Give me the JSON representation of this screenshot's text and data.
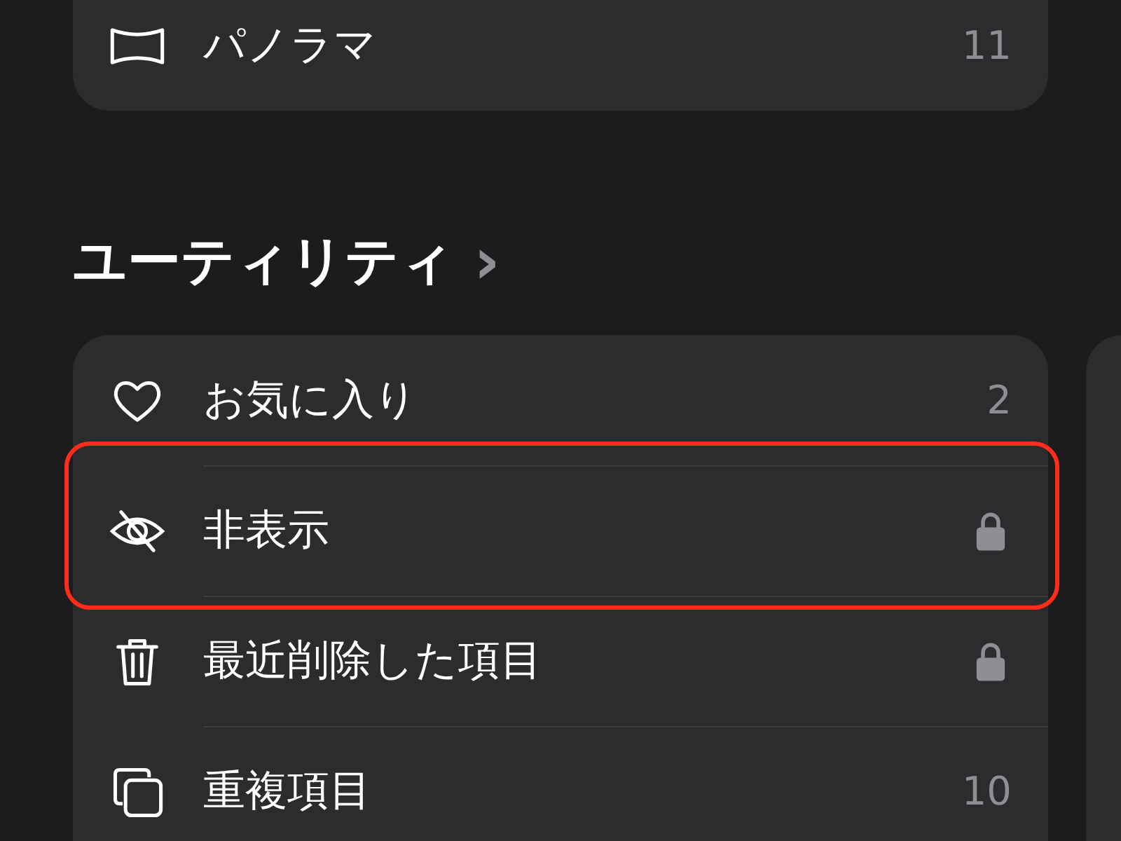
{
  "top_section": {
    "rows": [
      {
        "label": "パノラマ",
        "trailing": {
          "kind": "count",
          "text": "11"
        }
      }
    ]
  },
  "utilities": {
    "title": "ユーティリティ",
    "chevron": "›",
    "rows": [
      {
        "label": "お気に入り",
        "trailing": {
          "kind": "count",
          "text": "2"
        },
        "highlighted": false
      },
      {
        "label": "非表示",
        "trailing": {
          "kind": "lock"
        },
        "highlighted": true
      },
      {
        "label": "最近削除した項目",
        "trailing": {
          "kind": "lock"
        },
        "highlighted": false
      },
      {
        "label": "重複項目",
        "trailing": {
          "kind": "count",
          "text": "10"
        },
        "highlighted": false
      }
    ]
  }
}
